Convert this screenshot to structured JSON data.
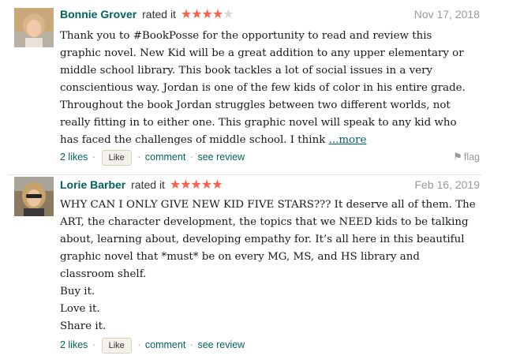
{
  "reviews": [
    {
      "author": "Bonnie Grover",
      "rated_text": "rated it",
      "rating": 4,
      "max_rating": 5,
      "date": "Nov 17, 2018",
      "body_lines": [
        "Thank you to #BookPosse for the opportunity to read and review this",
        "graphic novel. New Kid will be a great addition to any upper elementary or",
        "middle school library. This book tackles a lot of social issues in a very",
        "conscientious way. Jordan is one of the few kids of color in his entire grade.",
        "Throughout the book Jordan struggles between two different worlds, not",
        "really fitting in to either one. This graphic novel will speak to any kid who",
        "has faced the challenges of middle school. I think "
      ],
      "more_label": "...more",
      "likes_label": "2 likes",
      "like_button": "Like",
      "comment_label": "comment",
      "see_review_label": "see review",
      "flag_label": "flag"
    },
    {
      "author": "Lorie Barber",
      "rated_text": "rated it",
      "rating": 5,
      "max_rating": 5,
      "date": "Feb 16, 2019",
      "body_lines": [
        "WHY CAN I ONLY GIVE NEW KID FIVE STARS??? It deserve all of them. The",
        "ART, the character development, the topics that we NEED kids to be talking",
        "about, learning about, developing empathy for. It’s all here in this beautiful",
        "graphic novel that *must* be on every MG, MS, and HS library and",
        "classroom shelf.",
        "Buy it.",
        "Love it.",
        "Share it."
      ],
      "likes_label": "2 likes",
      "like_button": "Like",
      "comment_label": "comment",
      "see_review_label": "see review"
    }
  ],
  "colors": {
    "author_link": "#00635d",
    "star_on": "#fa604a",
    "star_off": "#d8d8d8",
    "muted": "#999999"
  },
  "icons": {
    "flag": "flag-icon",
    "star": "star-icon"
  }
}
